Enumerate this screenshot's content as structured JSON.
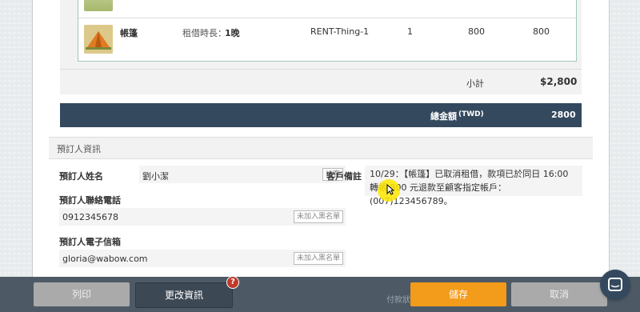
{
  "items": [
    {
      "name": "帳篷",
      "duration_label": "租借時長：",
      "duration_value": "1晚",
      "sku": "RENT-Thing-1",
      "qty": "1",
      "price": "800",
      "amount": "800"
    }
  ],
  "subtotal": {
    "label": "小計",
    "value": "$2,800"
  },
  "total": {
    "label": "總金額",
    "currency": "(TWD)",
    "value": "2800"
  },
  "booker_section": {
    "title": "預訂人資訊",
    "name_label": "預訂人姓名",
    "name_value": "劉小潔",
    "name_tag": "訪客",
    "phone_label": "預訂人聯絡電話",
    "phone_value": "0912345678",
    "phone_tag": "未加入黑名單",
    "email_label": "預訂人電子信箱",
    "email_value": "gloria@wabow.com",
    "email_tag": "未加入黑名單",
    "notes_label": "客戶備註",
    "notes_value": "10/29：【帳篷】已取消租借，款項已於同日 16:00 轉帳 800 元退款至顧客指定帳戶：(007)123456789。"
  },
  "footer": {
    "print": "列印",
    "edit": "更改資訊",
    "help": "?",
    "faint_text": "付款狀",
    "save": "儲存",
    "cancel": "取消"
  },
  "colors": {
    "accent": "#f39b1a",
    "total_bar": "#34495e",
    "footer": "#4d5a66"
  }
}
